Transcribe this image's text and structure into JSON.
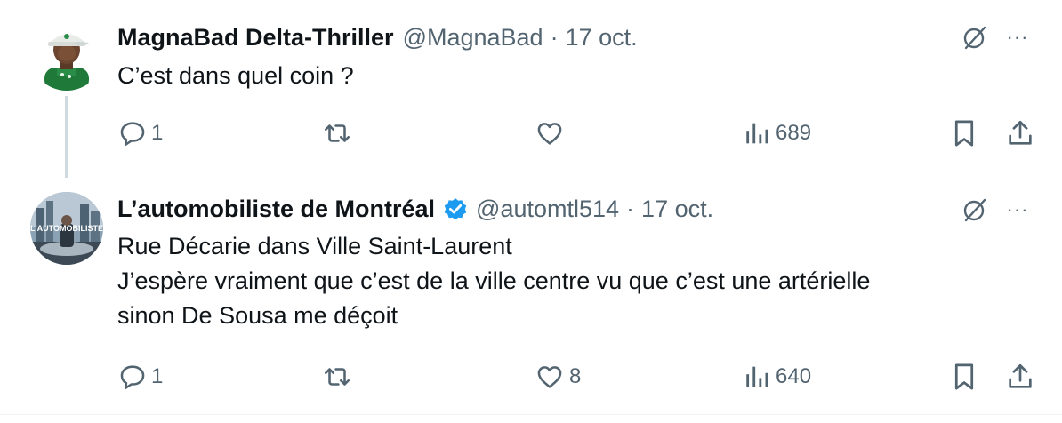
{
  "tweets": [
    {
      "name": "MagnaBad Delta-Thriller",
      "handle": "@MagnaBad",
      "separator": "·",
      "date": "17 oct.",
      "verified": false,
      "text_lines": [
        "C’est dans quel coin ?"
      ],
      "replies": "1",
      "retweets": "",
      "likes": "",
      "views": "689",
      "avatar_icon": "cartoon-avatar-green-shirt-cap"
    },
    {
      "name": "L’automobiliste de Montréal",
      "handle": "@automtl514",
      "separator": "·",
      "date": "17 oct.",
      "verified": true,
      "avatar_text": "L'AUTOMOBILISTE",
      "text_lines": [
        "Rue Décarie dans Ville Saint-Laurent",
        "J’espère vraiment que c’est de la ville centre vu que c’est une artérielle",
        "sinon De Sousa me déçoit"
      ],
      "replies": "1",
      "retweets": "",
      "likes": "8",
      "views": "640",
      "avatar_icon": "city-skyline-avatar"
    }
  ],
  "icons": {
    "reply": "speech-bubble-icon",
    "retweet": "retweet-arrows-icon",
    "like": "heart-icon",
    "views": "bar-chart-icon",
    "bookmark": "bookmark-icon",
    "share": "share-upload-icon",
    "grok": "grok-slash-circle-icon",
    "more": "ellipsis-icon",
    "verified": "verified-badge-icon"
  },
  "colors": {
    "text_primary": "#0f1419",
    "text_secondary": "#536471",
    "verified_blue": "#1d9bf0",
    "thread_line": "#cfd9de"
  },
  "more_label": "···"
}
